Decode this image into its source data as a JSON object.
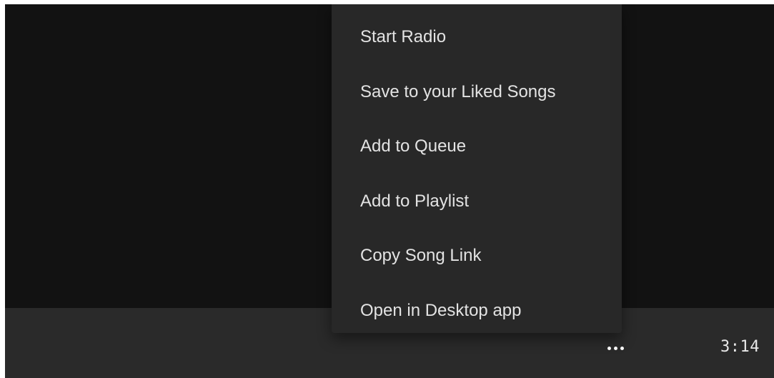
{
  "context_menu": {
    "items": [
      {
        "label": "Start Radio"
      },
      {
        "label": "Save to your Liked Songs"
      },
      {
        "label": "Add to Queue"
      },
      {
        "label": "Add to Playlist"
      },
      {
        "label": "Copy Song Link"
      },
      {
        "label": "Open in Desktop app"
      }
    ]
  },
  "track_row": {
    "more_icon": "more-horizontal-icon",
    "duration": "3:14"
  },
  "colors": {
    "background": "#121212",
    "menu_background": "#282828",
    "row_background": "#2a2a2a",
    "menu_text": "#e3e3e3"
  }
}
